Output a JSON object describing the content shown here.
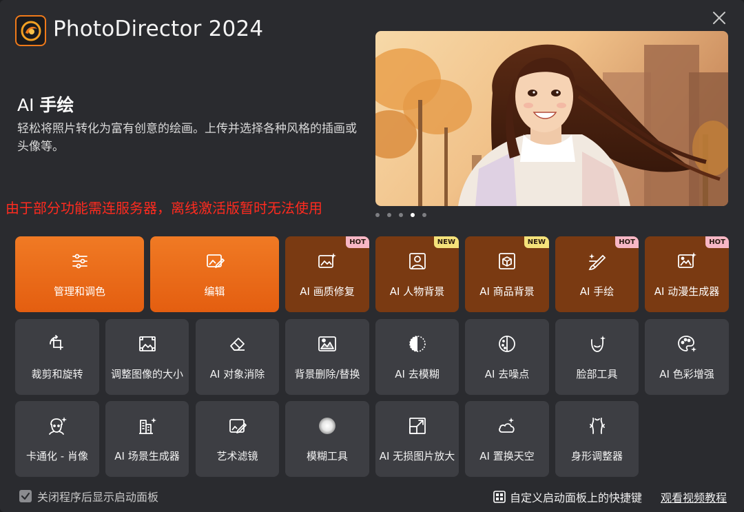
{
  "app": {
    "title": "PhotoDirector 2024",
    "logo_icon": "photodirector-logo-icon",
    "close_icon": "close-icon"
  },
  "feature": {
    "title_prefix": "AI ",
    "title_main": "手绘",
    "description": "轻松将照片转化为富有创意的绘画。上传并选择各种风格的插画或头像等。"
  },
  "notice": "由于部分功能需连服务器，离线激活版暂时无法使用",
  "carousel": {
    "page_count": 5,
    "active_index": 3
  },
  "tiles": {
    "row1": [
      {
        "label": "管理和调色",
        "icon": "sliders-icon",
        "style": "big",
        "badge": ""
      },
      {
        "label": "编辑",
        "icon": "image-edit-icon",
        "style": "big",
        "badge": ""
      },
      {
        "label": "AI 画质修复",
        "icon": "image-sparkle-icon",
        "style": "ai",
        "badge": "HOT"
      },
      {
        "label": "AI 人物背景",
        "icon": "person-frame-icon",
        "style": "ai",
        "badge": "NEW"
      },
      {
        "label": "AI 商品背景",
        "icon": "product-frame-icon",
        "style": "ai",
        "badge": "NEW"
      },
      {
        "label": "AI 手绘",
        "icon": "brush-sparkle-icon",
        "style": "ai",
        "badge": "HOT"
      },
      {
        "label": "AI 动漫生成器",
        "icon": "anime-frame-icon",
        "style": "ai",
        "badge": "HOT"
      }
    ],
    "row2": [
      {
        "label": "裁剪和旋转",
        "icon": "crop-rotate-icon"
      },
      {
        "label": "调整图像的大小",
        "icon": "resize-image-icon"
      },
      {
        "label": "AI 对象消除",
        "icon": "eraser-icon"
      },
      {
        "label": "背景删除/替换",
        "icon": "background-swap-icon"
      },
      {
        "label": "AI 去模糊",
        "icon": "deblur-icon"
      },
      {
        "label": "AI 去噪点",
        "icon": "denoise-icon"
      },
      {
        "label": "脸部工具",
        "icon": "face-icon"
      },
      {
        "label": "AI 色彩增强",
        "icon": "palette-sparkle-icon"
      }
    ],
    "row3": [
      {
        "label": "卡通化 - 肖像",
        "icon": "cartoon-face-icon"
      },
      {
        "label": "AI 场景生成器",
        "icon": "scene-sparkle-icon"
      },
      {
        "label": "艺术滤镜",
        "icon": "art-filter-icon"
      },
      {
        "label": "模糊工具",
        "icon": "blur-circle-icon"
      },
      {
        "label": "AI 无损图片放大",
        "icon": "upscale-icon"
      },
      {
        "label": "AI 置换天空",
        "icon": "sky-sparkle-icon"
      },
      {
        "label": "身形调整器",
        "icon": "body-shape-icon"
      }
    ]
  },
  "footer": {
    "checkbox_label": "关闭程序后显示启动面板",
    "checkbox_checked": true,
    "customize_label": "自定义启动面板上的快捷键",
    "tutorial_label": "观看视频教程"
  },
  "colors": {
    "accent": "#f07a24",
    "ai_tile": "#7a3a12",
    "tile": "#3d3e43",
    "background": "#2a2b2f",
    "notice": "#ff2b1f"
  }
}
